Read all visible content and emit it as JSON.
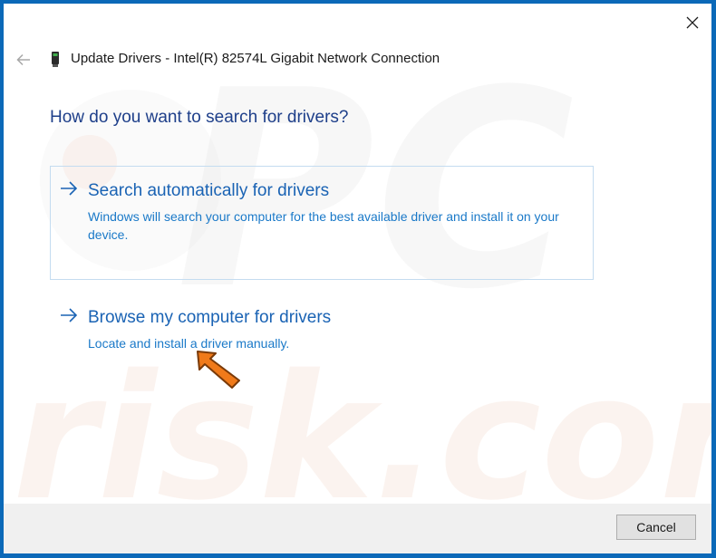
{
  "window": {
    "title": "Update Drivers - Intel(R) 82574L Gigabit Network Connection",
    "close_icon": "close-icon",
    "back_icon": "back-arrow-icon",
    "device_icon": "network-adapter-icon"
  },
  "main": {
    "heading": "How do you want to search for drivers?",
    "options": [
      {
        "title": "Search automatically for drivers",
        "description": "Windows will search your computer for the best available driver and install it on your device.",
        "icon": "right-arrow-icon"
      },
      {
        "title": "Browse my computer for drivers",
        "description": "Locate and install a driver manually.",
        "icon": "right-arrow-icon"
      }
    ]
  },
  "footer": {
    "cancel_label": "Cancel"
  },
  "overlay": {
    "pointer_icon": "orange-pointer-arrow-icon",
    "watermark": "pcrisk.com"
  },
  "colors": {
    "frame": "#0b69b8",
    "heading": "#1e3f8a",
    "link": "#1a63b4",
    "pointer": "#f07a1a"
  }
}
